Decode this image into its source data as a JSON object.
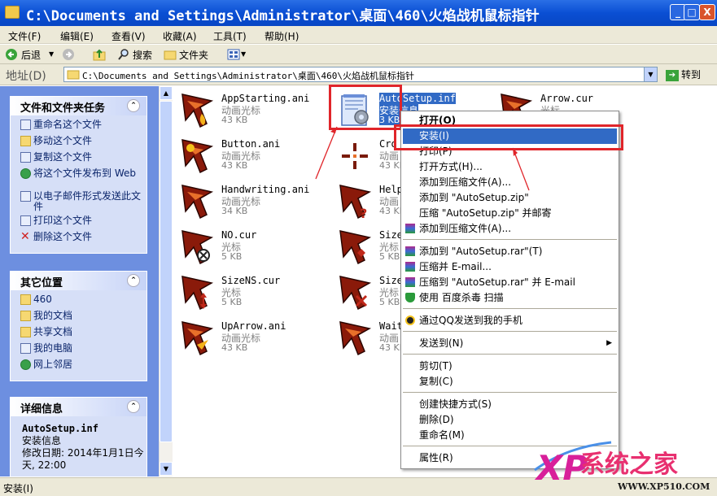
{
  "window": {
    "title": "C:\\Documents and Settings\\Administrator\\桌面\\460\\火焰战机鼠标指针",
    "buttons": {
      "minimize": "_",
      "maximize": "□",
      "close": "X"
    }
  },
  "menubar": [
    "文件(F)",
    "编辑(E)",
    "查看(V)",
    "收藏(A)",
    "工具(T)",
    "帮助(H)"
  ],
  "toolbar": {
    "back": "后退",
    "search": "搜索",
    "folders": "文件夹"
  },
  "address": {
    "label": "地址(D)",
    "path": "C:\\Documents and Settings\\Administrator\\桌面\\460\\火焰战机鼠标指针",
    "go": "转到"
  },
  "sidebar": {
    "tasks": {
      "title": "文件和文件夹任务",
      "items": [
        {
          "label": "重命名这个文件",
          "icon": "rename-icon"
        },
        {
          "label": "移动这个文件",
          "icon": "move-icon"
        },
        {
          "label": "复制这个文件",
          "icon": "copy-icon"
        },
        {
          "label": "将这个文件发布到 Web",
          "icon": "publish-web-icon"
        },
        {
          "label": "以电子邮件形式发送此文件",
          "icon": "email-icon"
        },
        {
          "label": "打印这个文件",
          "icon": "print-icon"
        },
        {
          "label": "删除这个文件",
          "icon": "delete-icon"
        }
      ]
    },
    "places": {
      "title": "其它位置",
      "items": [
        {
          "label": "460",
          "icon": "folder-icon"
        },
        {
          "label": "我的文档",
          "icon": "folder-icon"
        },
        {
          "label": "共享文档",
          "icon": "folder-icon"
        },
        {
          "label": "我的电脑",
          "icon": "computer-icon"
        },
        {
          "label": "网上邻居",
          "icon": "network-icon"
        }
      ]
    },
    "details": {
      "title": "详细信息",
      "name": "AutoSetup.inf",
      "type": "安装信息",
      "modified": "修改日期: 2014年1月1日今天, 22:00"
    }
  },
  "files": [
    {
      "name": "AppStarting.ani",
      "type": "动画光标",
      "size": "43 KB"
    },
    {
      "name": "Button.ani",
      "type": "动画光标",
      "size": "43 KB"
    },
    {
      "name": "Handwriting.ani",
      "type": "动画光标",
      "size": "34 KB"
    },
    {
      "name": "NO.cur",
      "type": "光标",
      "size": "5 KB"
    },
    {
      "name": "SizeNS.cur",
      "type": "光标",
      "size": "5 KB"
    },
    {
      "name": "UpArrow.ani",
      "type": "动画光标",
      "size": "43 KB"
    },
    {
      "name": "AutoSetup.inf",
      "type": "安装信息",
      "size": "3 KB"
    },
    {
      "name": "Cro",
      "type": "动画",
      "size": "43 KB"
    },
    {
      "name": "Help",
      "type": "动画",
      "size": "43 KB"
    },
    {
      "name": "Size",
      "type": "光标",
      "size": "5 KB"
    },
    {
      "name": "Size",
      "type": "光标",
      "size": "5 KB"
    },
    {
      "name": "Wait",
      "type": "动画",
      "size": "43 KB"
    },
    {
      "name": "Arrow.cur",
      "type": "光标",
      "size": ""
    }
  ],
  "context_menu": [
    {
      "label": "打开(O)",
      "bold": true
    },
    {
      "label": "安装(I)",
      "highlight": true
    },
    {
      "label": "打印(P)"
    },
    {
      "label": "打开方式(H)..."
    },
    {
      "label": "添加到压缩文件(A)..."
    },
    {
      "label": "添加到 \"AutoSetup.zip\""
    },
    {
      "label": "压缩 \"AutoSetup.zip\" 并邮寄"
    },
    {
      "label": "添加到压缩文件(A)..."
    },
    {
      "label": "添加到 \"AutoSetup.rar\"(T)"
    },
    {
      "label": "压缩并 E-mail..."
    },
    {
      "label": "压缩到 \"AutoSetup.rar\" 并 E-mail"
    },
    {
      "label": "使用 百度杀毒 扫描"
    },
    {
      "label": "通过QQ发送到我的手机"
    },
    {
      "label": "发送到(N)"
    },
    {
      "label": "剪切(T)"
    },
    {
      "label": "复制(C)"
    },
    {
      "label": "创建快捷方式(S)"
    },
    {
      "label": "删除(D)"
    },
    {
      "label": "重命名(M)"
    },
    {
      "label": "属性(R)"
    }
  ],
  "status": "安装(I)",
  "watermark": {
    "brand": "系统之家",
    "logo": "XP",
    "url": "WWW.XP510.COM"
  }
}
